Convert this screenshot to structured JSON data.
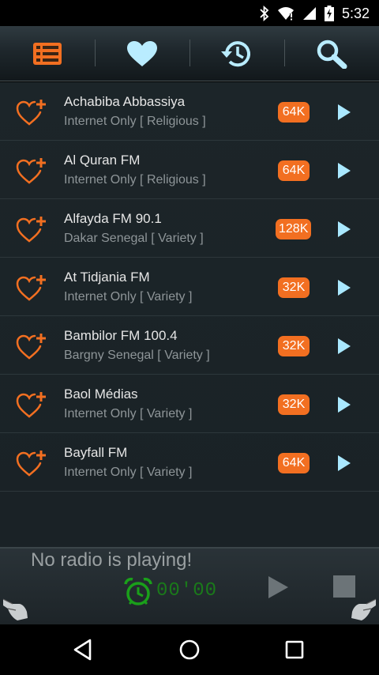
{
  "status_bar": {
    "time": "5:32",
    "icons": [
      "bluetooth-icon",
      "wifi-icon",
      "signal-icon",
      "battery-charging-icon"
    ]
  },
  "toolbar": {
    "items": [
      {
        "name": "station-list",
        "icon": "list-icon"
      },
      {
        "name": "favorites",
        "icon": "heart-icon"
      },
      {
        "name": "history",
        "icon": "history-icon"
      },
      {
        "name": "search",
        "icon": "search-icon"
      }
    ]
  },
  "stations": [
    {
      "name": "Achabiba Abbassiya",
      "info": "Internet Only [ Religious ]",
      "bitrate": "64K"
    },
    {
      "name": "Al Quran FM",
      "info": "Internet Only [ Religious ]",
      "bitrate": "64K"
    },
    {
      "name": "Alfayda FM 90.1",
      "info": "Dakar Senegal [ Variety ]",
      "bitrate": "128K"
    },
    {
      "name": "At Tidjania FM",
      "info": "Internet Only [ Variety ]",
      "bitrate": "32K"
    },
    {
      "name": "Bambilor FM 100.4",
      "info": "Bargny Senegal [ Variety ]",
      "bitrate": "32K"
    },
    {
      "name": "Baol Médias",
      "info": "Internet Only [ Variety ]",
      "bitrate": "32K"
    },
    {
      "name": "Bayfall FM",
      "info": "Internet Only [ Variety ]",
      "bitrate": "64K"
    }
  ],
  "player": {
    "status": "No radio is playing!",
    "sleep_timer": "00'00"
  },
  "colors": {
    "accent": "#f26f21",
    "play_arrow": "#a9e8ff",
    "toolbar_icon": "#b9ecff",
    "timer_green": "#1aa01a"
  },
  "navbar": {
    "items": [
      "back-icon",
      "home-icon",
      "recents-icon"
    ]
  }
}
